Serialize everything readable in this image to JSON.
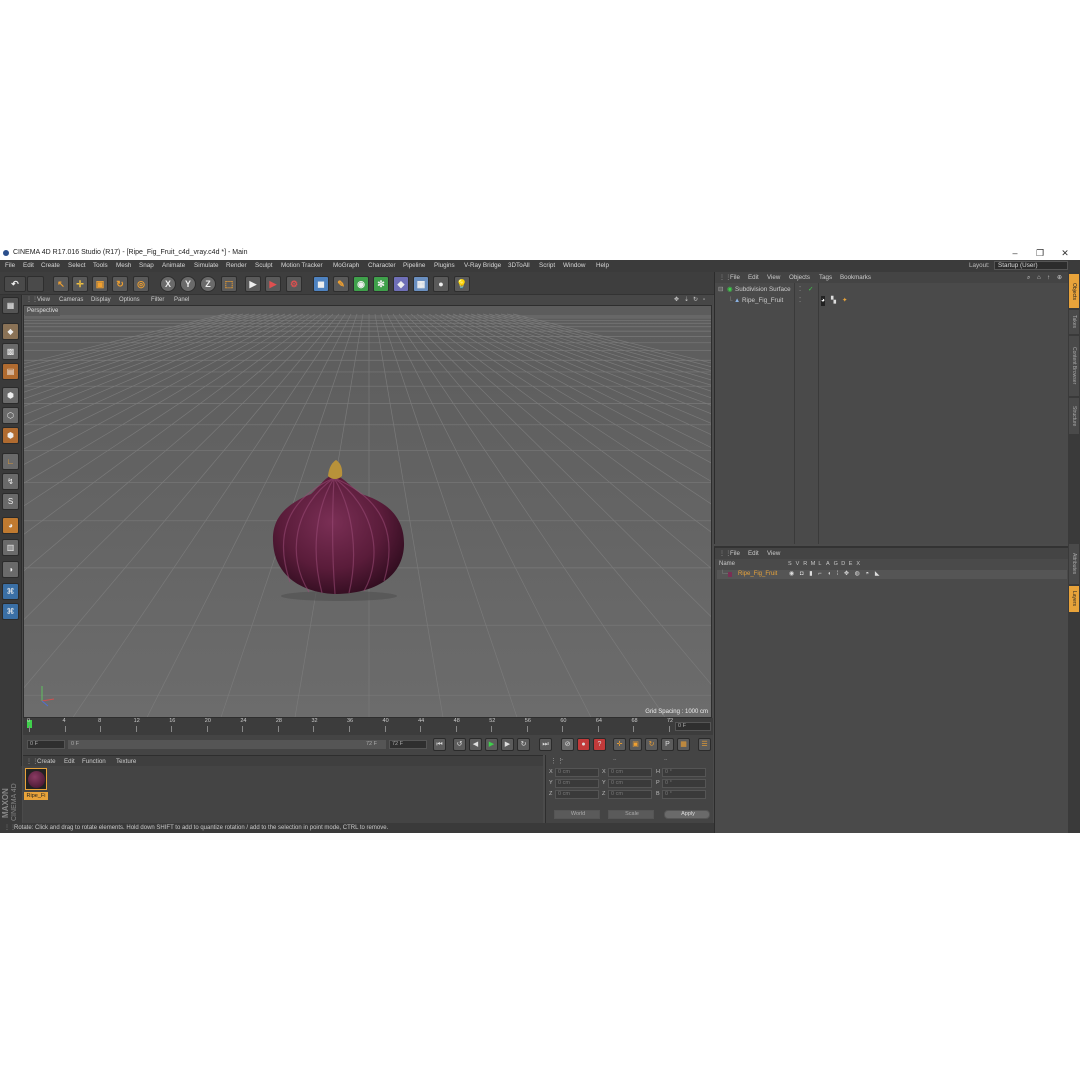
{
  "window": {
    "title": "CINEMA 4D R17.016 Studio (R17) - [Ripe_Fig_Fruit_c4d_vray.c4d *] - Main",
    "minimize": "–",
    "maximize": "❐",
    "close": "✕"
  },
  "menubar": {
    "items": [
      "File",
      "Edit",
      "Create",
      "Select",
      "Tools",
      "Mesh",
      "Snap",
      "Animate",
      "Simulate",
      "Render",
      "Sculpt",
      "Motion Tracker",
      "MoGraph",
      "Character",
      "Pipeline",
      "Plugins",
      "V-Ray Bridge",
      "3DToAll",
      "Script",
      "Window",
      "Help"
    ],
    "layout_label": "Layout:",
    "layout_value": "Startup (User)"
  },
  "toolbar": {
    "axis_x": "X",
    "axis_y": "Y",
    "axis_z": "Z"
  },
  "viewport": {
    "menu": [
      "View",
      "Cameras",
      "Display",
      "Options",
      "Filter",
      "Panel"
    ],
    "label": "Perspective",
    "grid_spacing": "Grid Spacing : 1000 cm"
  },
  "timeline": {
    "ticks": [
      "0",
      "4",
      "8",
      "12",
      "16",
      "20",
      "24",
      "28",
      "32",
      "36",
      "40",
      "44",
      "48",
      "52",
      "56",
      "60",
      "64",
      "68",
      "72"
    ],
    "current_frame": "0 F"
  },
  "transport": {
    "start_frame": "0 F",
    "range_start": "0 F",
    "range_end": "72 F",
    "end_frame": "72 F"
  },
  "material_manager": {
    "menu": [
      "Create",
      "Edit",
      "Function",
      "Texture"
    ],
    "material_name": "Ripe_Fi"
  },
  "coordinates": {
    "header": [
      "--",
      "--",
      "--"
    ],
    "rows": [
      {
        "a": "X",
        "av": "0 cm",
        "b": "X",
        "bv": "0 cm",
        "c": "H",
        "cv": "0 °"
      },
      {
        "a": "Y",
        "av": "0 cm",
        "b": "Y",
        "bv": "0 cm",
        "c": "P",
        "cv": "0 °"
      },
      {
        "a": "Z",
        "av": "0 cm",
        "b": "Z",
        "bv": "0 cm",
        "c": "B",
        "cv": "0 °"
      }
    ],
    "mode1": "World",
    "mode2": "Scale",
    "apply": "Apply"
  },
  "brand": {
    "maxon": "MAXON",
    "cinema": "CINEMA 4D"
  },
  "status": "Rotate: Click and drag to rotate elements. Hold down SHIFT to add to quantize rotation / add to the selection in point mode, CTRL to remove.",
  "object_manager": {
    "menu": [
      "File",
      "Edit",
      "View",
      "Objects",
      "Tags",
      "Bookmarks"
    ],
    "objects": [
      "Subdivision Surface",
      "Ripe_Fig_Fruit"
    ]
  },
  "attribute_manager": {
    "menu": [
      "File",
      "Edit",
      "View"
    ],
    "col_name": "Name",
    "cols": [
      "S",
      "V",
      "R",
      "M",
      "L",
      "A",
      "G",
      "D",
      "E",
      "X"
    ],
    "row_name": "Ripe_Fig_Fruit"
  },
  "right_tabs": [
    "Objects",
    "Takes",
    "Content Browser",
    "Structure",
    "Attributes",
    "Layers"
  ],
  "colors": {
    "accent": "#e8a33a",
    "bg": "#4b4b4b",
    "fig": "#5e1f3c"
  }
}
